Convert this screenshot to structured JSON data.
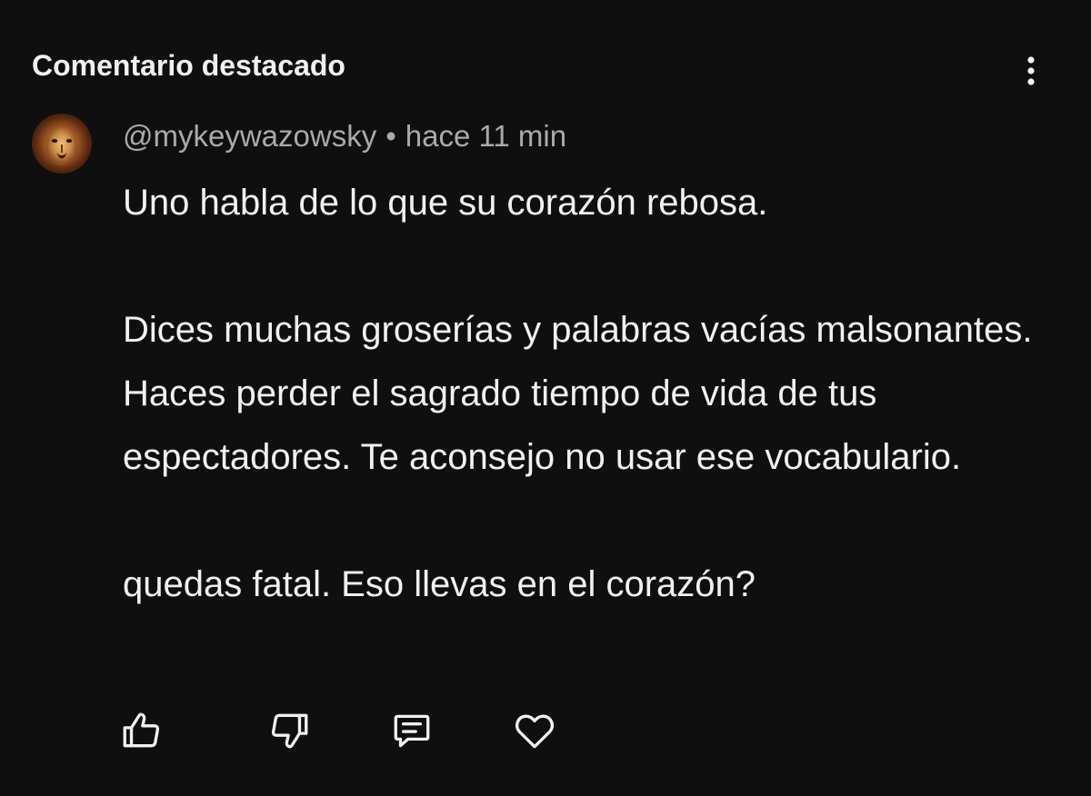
{
  "header": {
    "title": "Comentario destacado",
    "more_icon": "more-vertical-icon"
  },
  "comment": {
    "author": "@mykeywazowsky",
    "separator": "•",
    "time": "hace 11 min",
    "avatar_icon": "lion-avatar",
    "paragraphs": [
      "Uno habla de lo que su corazón rebosa.",
      "Dices muchas groserías y palabras vacías malsonantes. Haces perder el sagrado tiempo de vida de tus espectadores. Te aconsejo no usar ese vocabulario.",
      "quedas fatal. Eso llevas en el corazón?"
    ]
  },
  "actions": {
    "items": [
      {
        "icon": "thumbs-up-icon"
      },
      {
        "icon": "thumbs-down-icon"
      },
      {
        "icon": "reply-icon"
      },
      {
        "icon": "heart-icon"
      }
    ]
  },
  "colors": {
    "background": "#0f0f0f",
    "text_primary": "#f1f1f1",
    "text_secondary": "#aaaaaa"
  }
}
